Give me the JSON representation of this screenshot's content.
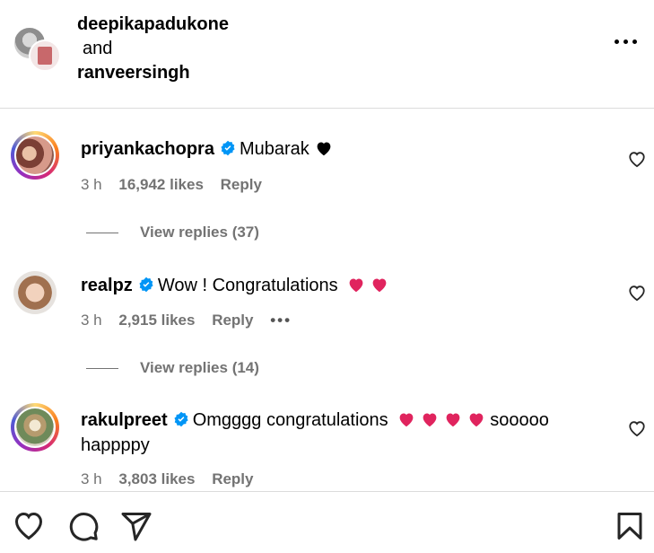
{
  "header": {
    "user1": "deepikapadukone",
    "conjunction": "and",
    "user2": "ranveersingh"
  },
  "comments": [
    {
      "username": "priyankachopra",
      "text": "Mubarak",
      "time": "3 h",
      "likes": "16,942 likes",
      "reply": "Reply",
      "view_replies": "View replies (37)"
    },
    {
      "username": "realpz",
      "text": "Wow ! Congratulations",
      "time": "3 h",
      "likes": "2,915 likes",
      "reply": "Reply",
      "more": "•••",
      "view_replies": "View replies (14)"
    },
    {
      "username": "rakulpreet",
      "text": "Omgggg congratulations",
      "text_after": "sooooo happppy",
      "time": "3 h",
      "likes": "3,803 likes",
      "reply": "Reply"
    }
  ],
  "colors": {
    "verified": "#0095f6",
    "heart_red": "#e0245e",
    "meta_gray": "#737373",
    "divider": "#dbdbdb"
  },
  "icons": [
    "heart-icon",
    "comment-icon",
    "share-icon",
    "bookmark-icon",
    "verified-badge-icon",
    "more-icon"
  ]
}
